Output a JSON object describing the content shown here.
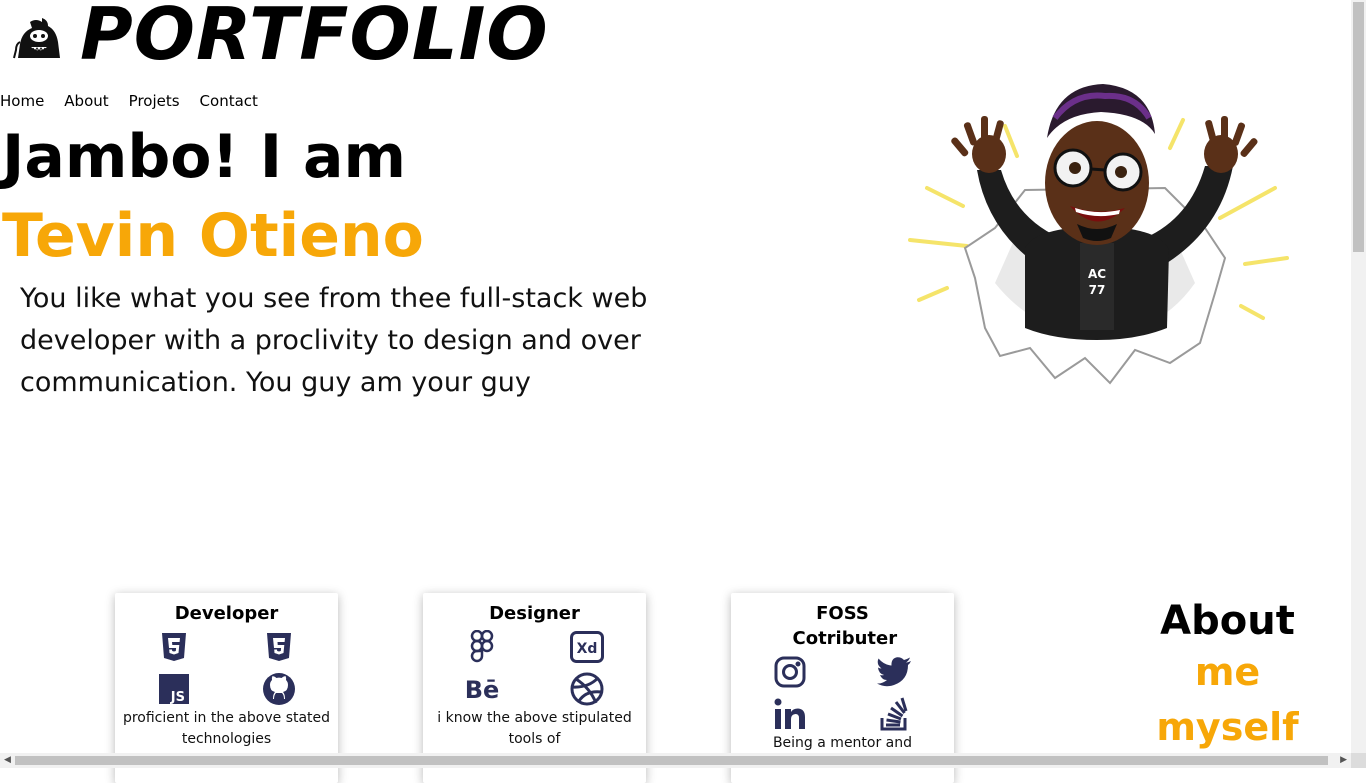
{
  "header": {
    "brand": "PORTFOLIO",
    "logo_icon": "gorilla-logo-icon"
  },
  "nav": [
    {
      "label": "Home"
    },
    {
      "label": "About"
    },
    {
      "label": "Projets"
    },
    {
      "label": "Contact"
    }
  ],
  "hero": {
    "greeting": "Jambo! I am",
    "name": "Tevin Otieno",
    "bio": "You like what you see from thee full-stack web developer with a proclivity to design and over communication. You guy am your guy",
    "avatar_icon": "bitmoji-avatar-icon"
  },
  "cards": [
    {
      "title": "Developer",
      "icons": [
        "html5-icon",
        "css3-icon",
        "javascript-icon",
        "github-icon"
      ],
      "text": "proficient in the above stated technologies"
    },
    {
      "title": "Designer",
      "icons": [
        "figma-icon",
        "adobe-xd-icon",
        "behance-icon",
        "dribbble-icon"
      ],
      "text": "i know the above stipulated tools of"
    },
    {
      "title": "FOSS Cotributer",
      "icons": [
        "instagram-icon",
        "twitter-icon",
        "linkedin-icon",
        "stackoverflow-icon"
      ],
      "text": "Being a mentor and"
    }
  ],
  "about": {
    "line1": "About",
    "line2": "me",
    "line3": "myself"
  },
  "colors": {
    "accent": "#f7a708",
    "icon": "#2b2f5a"
  }
}
